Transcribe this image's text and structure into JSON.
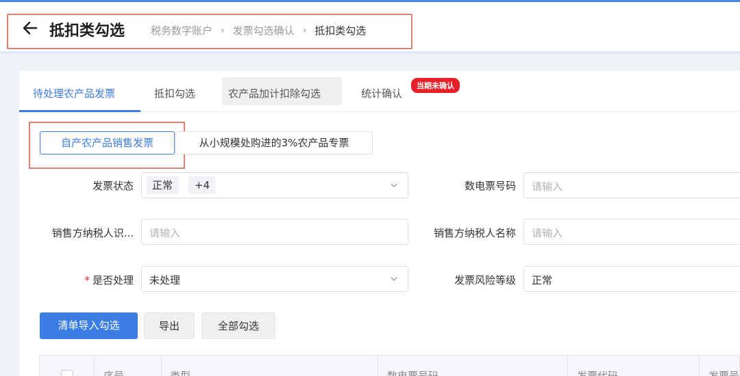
{
  "header": {
    "title": "抵扣类勾选",
    "breadcrumb": [
      "税务数字账户",
      "发票勾选确认",
      "抵扣类勾选"
    ]
  },
  "tabs": [
    {
      "label": "待处理农产品发票",
      "active": true
    },
    {
      "label": "抵扣勾选",
      "active": false
    },
    {
      "label": "农产品加计扣除勾选",
      "active": false
    },
    {
      "label": "统计确认",
      "active": false
    }
  ],
  "badge": "当期未确认",
  "sub_tabs": [
    {
      "label": "自产农产品销售发票",
      "active": true
    },
    {
      "label": "从小规模处购进的3%农产品专票",
      "active": false
    }
  ],
  "filters": {
    "invoice_status": {
      "label": "发票状态",
      "tags": [
        "正常",
        "+4"
      ]
    },
    "invoice_number": {
      "label": "数电票号码",
      "placeholder": "请输入"
    },
    "seller_tax_id": {
      "label": "销售方纳税人识...",
      "placeholder": "请输入"
    },
    "seller_name": {
      "label": "销售方纳税人名称",
      "placeholder": "请输入"
    },
    "processed": {
      "label": "是否处理",
      "required_mark": "*",
      "value": "未处理"
    },
    "risk_level": {
      "label": "发票风险等级",
      "value": "正常"
    }
  },
  "actions": {
    "import_select": "清单导入勾选",
    "export": "导出",
    "select_all": "全部勾选"
  },
  "table": {
    "columns": [
      "序号",
      "类型",
      "数电票号码",
      "发票代码",
      "发票号"
    ]
  },
  "colors": {
    "accent": "#3b7de3",
    "badge": "#e8202a",
    "annotation": "#d9826f"
  }
}
